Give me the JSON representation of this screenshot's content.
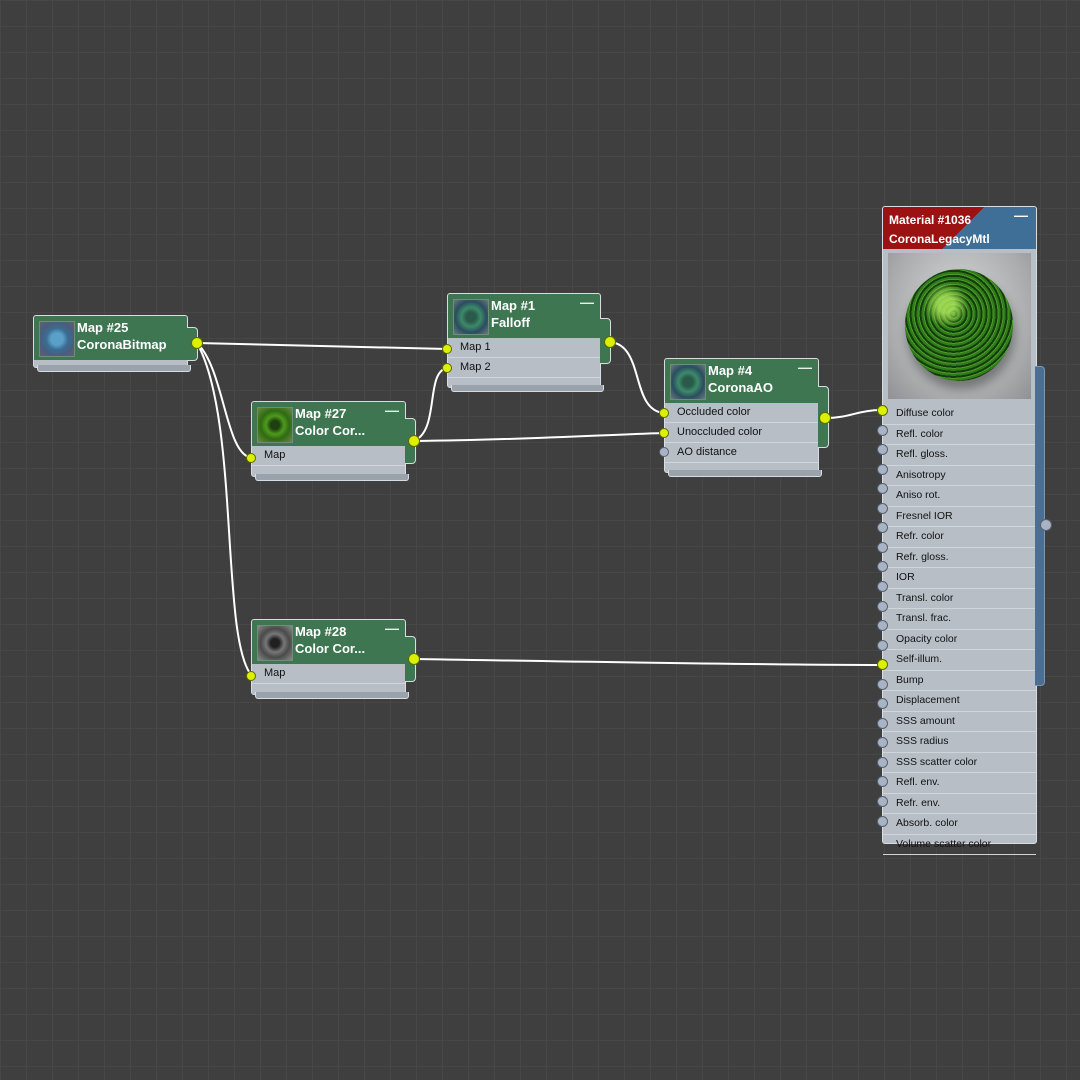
{
  "nodes": {
    "map25": {
      "name": "Map #25",
      "type": "CoronaBitmap",
      "slots": []
    },
    "map1": {
      "name": "Map #1",
      "type": "Falloff",
      "slots": [
        "Map 1",
        "Map 2"
      ]
    },
    "map27": {
      "name": "Map #27",
      "type": "Color  Cor...",
      "slots": [
        "Map"
      ]
    },
    "map4": {
      "name": "Map #4",
      "type": "CoronaAO",
      "slots": [
        "Occluded color",
        "Unoccluded color",
        "AO distance"
      ]
    },
    "map28": {
      "name": "Map #28",
      "type": "Color  Cor...",
      "slots": [
        "Map"
      ]
    }
  },
  "material": {
    "name": "Material #1036",
    "type": "CoronaLegacyMtl",
    "slots": [
      "Diffuse color",
      "Refl. color",
      "Refl. gloss.",
      "Anisotropy",
      "Aniso rot.",
      "Fresnel IOR",
      "Refr. color",
      "Refr. gloss.",
      "IOR",
      "Transl. color",
      "Transl. frac.",
      "Opacity color",
      "Self-illum.",
      "Bump",
      "Displacement",
      "SSS amount",
      "SSS radius",
      "SSS scatter color",
      "Refl. env.",
      "Refr. env.",
      "Absorb. color",
      "Volume scatter color"
    ],
    "connected_slots": [
      "Diffuse color",
      "Bump"
    ]
  },
  "minimize_glyph": "—",
  "colors": {
    "node_header": "#3e7651",
    "socket_active": "#dcf000",
    "socket_inactive": "#a8b4c6",
    "material_header_red": "#9c1212",
    "material_header_blue": "#3f6f96",
    "wire": "#ffffff"
  }
}
